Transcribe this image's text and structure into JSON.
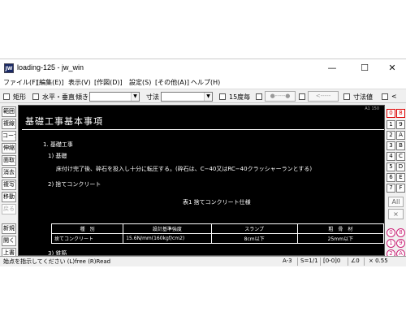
{
  "window": {
    "icon_text": "JW",
    "title": "loading-125 - jw_win",
    "minimize": "—",
    "maximize": "☐",
    "close": "✕"
  },
  "menu": [
    "ファイル(F)",
    "[編集(E)]",
    "表示(V)",
    "[作図(D)]",
    "設定(S)",
    "[その他(A)]",
    "ヘルプ(H)"
  ],
  "toolbar": {
    "rect_label": "矩形",
    "hv_label": "水平・垂直",
    "slope_label": "傾き",
    "slope_value": "",
    "dim_label": "寸法",
    "dim_value": "",
    "deg15_label": "15度毎",
    "line_btn1": "●-----●",
    "line_btn2": "<-----",
    "dimval_label": "寸法値",
    "less_label": "<"
  },
  "left_tools": [
    "範囲",
    "複線",
    "コーナー",
    "伸縮",
    "面取",
    "消去",
    "複写",
    "移動",
    "戻る",
    "新規",
    "開く",
    "上書"
  ],
  "canvas": {
    "corner_label": "A1 150",
    "title": "基礎工事基本事項",
    "section1": "1.  基礎工事",
    "sub1": "1)  基礎",
    "para1": "床付け完了後、砕石を投入し十分に転圧する。(砕石は、C−40又はRC−40クラッシャーランとする)",
    "sub2": "2)  捨てコンクリート",
    "table_caption": "表1   捨てコンクリート仕様",
    "table_headers": [
      "種　別",
      "設計基準強度",
      "スランプ",
      "粗　骨　材"
    ],
    "table_row": [
      "捨てコンクリート",
      "15.6N/mm(160kgf/cm2)",
      "8cm以下",
      "25mm以下"
    ],
    "sub3": "3)  鉄筋"
  },
  "right_tools": {
    "row1": [
      "0",
      "8"
    ],
    "letters_left": [
      "1",
      "2",
      "3",
      "4",
      "5",
      "6",
      "7"
    ],
    "letters_right": [
      "9",
      "A",
      "B",
      "C",
      "D",
      "E",
      "F"
    ],
    "all_label": "All",
    "x_label": "×",
    "circles_left": [
      "0",
      "1",
      "2"
    ],
    "circles_right": [
      "8",
      "9",
      "A"
    ]
  },
  "status": {
    "message": "始点を指示してください (L)free (R)Read",
    "paper": "A-3",
    "scale": "S=1/1",
    "layer": "[0-0]0",
    "angle": "∠0",
    "zoom": "× 0.55"
  }
}
